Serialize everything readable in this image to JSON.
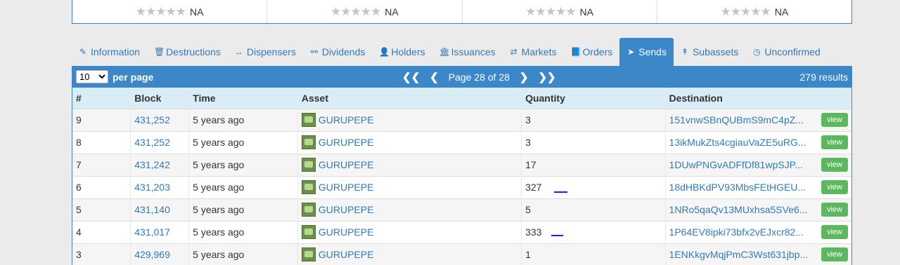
{
  "ratings": [
    {
      "stars": "★★★★★",
      "value": "NA"
    },
    {
      "stars": "★★★★★",
      "value": "NA"
    },
    {
      "stars": "★★★★★",
      "value": "NA"
    },
    {
      "stars": "★★★★★",
      "value": "NA"
    }
  ],
  "tabs": [
    {
      "label": "Information",
      "icon": "✎",
      "name": "information"
    },
    {
      "label": "Destructions",
      "icon": "🗑",
      "name": "destructions"
    },
    {
      "label": "Dispensers",
      "icon": "↔",
      "name": "dispensers"
    },
    {
      "label": "Dividends",
      "icon": "⚯",
      "name": "dividends"
    },
    {
      "label": "Holders",
      "icon": "👤",
      "name": "holders"
    },
    {
      "label": "Issuances",
      "icon": "🏛",
      "name": "issuances"
    },
    {
      "label": "Markets",
      "icon": "⇄",
      "name": "markets"
    },
    {
      "label": "Orders",
      "icon": "📘",
      "name": "orders"
    },
    {
      "label": "Sends",
      "icon": "➤",
      "name": "sends",
      "active": true
    },
    {
      "label": "Subassets",
      "icon": "↟",
      "name": "subassets"
    },
    {
      "label": "Unconfirmed",
      "icon": "◷",
      "name": "unconfirmed"
    }
  ],
  "pager": {
    "per_page_value": "10",
    "per_page_label": "per page",
    "first": "❮❮",
    "prev": "❮",
    "page_text": "Page 28 of 28",
    "next": "❯",
    "last": "❯❯",
    "results": "279 results"
  },
  "table": {
    "headers": [
      "#",
      "Block",
      "Time",
      "Asset",
      "Quantity",
      "Destination"
    ],
    "view_label": "view",
    "rows": [
      {
        "num": "9",
        "block": "431,252",
        "time": "5 years ago",
        "asset": "GURUPEPE",
        "quantity": "3",
        "destination": "151vnwSBnQUBmS9mC4pZ..."
      },
      {
        "num": "8",
        "block": "431,252",
        "time": "5 years ago",
        "asset": "GURUPEPE",
        "quantity": "3",
        "destination": "13ikMukZts4cgiauVaZE5uRG..."
      },
      {
        "num": "7",
        "block": "431,242",
        "time": "5 years ago",
        "asset": "GURUPEPE",
        "quantity": "17",
        "destination": "1DUwPNGvADFfDf81wpSJP..."
      },
      {
        "num": "6",
        "block": "431,203",
        "time": "5 years ago",
        "asset": "GURUPEPE",
        "quantity": "327",
        "destination": "18dHBKdPV93MbsFEtHGEU..."
      },
      {
        "num": "5",
        "block": "431,140",
        "time": "5 years ago",
        "asset": "GURUPEPE",
        "quantity": "5",
        "destination": "1NRo5qaQv13MUxhsa5SVe6..."
      },
      {
        "num": "4",
        "block": "431,017",
        "time": "5 years ago",
        "asset": "GURUPEPE",
        "quantity": "333",
        "destination": "1P64EV8ipki73bfx2vEJxcr82..."
      },
      {
        "num": "3",
        "block": "429,969",
        "time": "5 years ago",
        "asset": "GURUPEPE",
        "quantity": "1",
        "destination": "1ENKkgvMqjPmC3Wst631jbp..."
      }
    ]
  },
  "colors": {
    "accent": "#3b87c8",
    "header_row": "#d9edf7",
    "view_button": "#5cb85c",
    "link": "#337ab7"
  }
}
